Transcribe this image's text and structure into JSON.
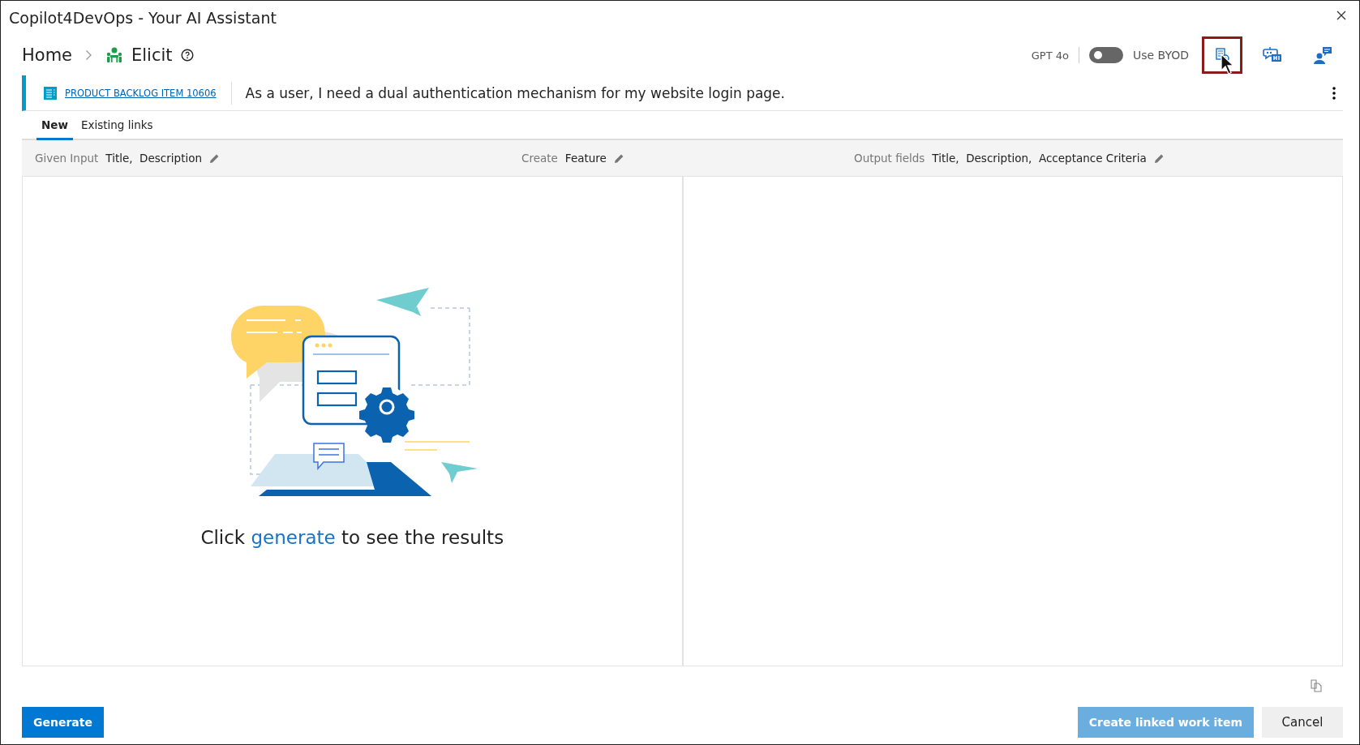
{
  "window": {
    "title": "Copilot4DevOps - Your AI Assistant"
  },
  "breadcrumb": [
    {
      "label": "Home"
    },
    {
      "label": "Elicit"
    }
  ],
  "header": {
    "model": "GPT 4o",
    "byod_toggle": {
      "label": "Use BYOD",
      "on": false
    },
    "tool_buttons": [
      {
        "kind": "doc-settings",
        "highlighted": true
      },
      {
        "kind": "chat-bot",
        "highlighted": false
      },
      {
        "kind": "person-chat",
        "highlighted": false
      }
    ]
  },
  "work_item": {
    "link": "PRODUCT BACKLOG ITEM 10606",
    "title": "As a user, I need a dual authentication mechanism for my website login page."
  },
  "tabs": [
    {
      "label": "New",
      "selected": true
    },
    {
      "label": "Existing links",
      "selected": false
    }
  ],
  "settings_bar": [
    {
      "label": "Given Input",
      "value": "Title,  Description"
    },
    {
      "label": "Create",
      "value": "Feature"
    },
    {
      "label": "Output fields",
      "value": "Title,  Description,  Acceptance Criteria"
    }
  ],
  "empty_state": {
    "before": "Click",
    "link": "generate",
    "after": "to see the results"
  },
  "buttons": [
    {
      "label": "Generate",
      "kind": "primary",
      "disabled": false
    },
    {
      "label": "Create linked work item",
      "kind": "primary",
      "disabled": true
    },
    {
      "label": "Cancel",
      "kind": "secondary",
      "disabled": false
    }
  ]
}
